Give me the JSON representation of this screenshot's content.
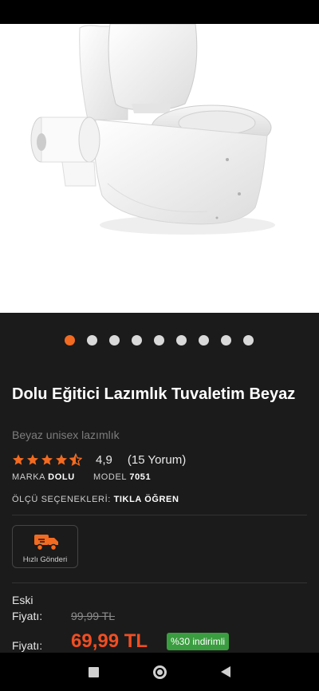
{
  "product": {
    "title": "Dolu Eğitici Lazımlık Tuvaletim Beyaz",
    "subtitle": "Beyaz unisex lazımlık",
    "rating": "4,9",
    "rating_stars": 4.5,
    "reviews": "(15 Yorum)",
    "brand_label": "MARKA",
    "brand_value": "DOLU",
    "model_label": "MODEL",
    "model_value": "7051",
    "size_label": "ÖLÇÜ SEÇENEKLERİ:",
    "size_link": "TIKLA ÖĞREN",
    "image_alt": "white toilet trainer potty with paper roll"
  },
  "gallery": {
    "count": 9,
    "active_index": 0
  },
  "shipping": {
    "label": "Hızlı Gönderi",
    "icon": "truck-icon"
  },
  "pricing": {
    "old_label": "Eski Fiyatı:",
    "old_price": "99,99 TL",
    "label": "Fiyatı:",
    "price": "69,99 TL",
    "discount": "%30 indirimli"
  },
  "colors": {
    "accent": "#f26b21",
    "price": "#f04e23",
    "discount_bg": "#3a9d3f",
    "background": "#1b1b1b"
  }
}
